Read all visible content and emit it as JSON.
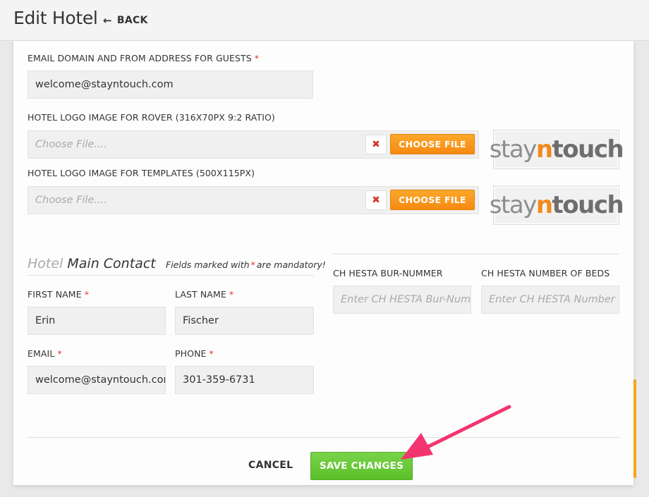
{
  "header": {
    "title": "Edit Hotel",
    "back_label": "BACK"
  },
  "form": {
    "email_domain": {
      "label": "EMAIL DOMAIN AND FROM ADDRESS FOR GUESTS",
      "value": "welcome@stayntouch.com"
    },
    "logo_rover": {
      "label": "HOTEL LOGO IMAGE FOR ROVER (316X70PX 9:2 RATIO)",
      "placeholder": "Choose File....",
      "choose_label": "CHOOSE FILE",
      "remove_label": "✖"
    },
    "logo_templates": {
      "label": "HOTEL LOGO IMAGE FOR TEMPLATES (500X115PX)",
      "placeholder": "Choose File....",
      "choose_label": "CHOOSE FILE",
      "remove_label": "✖"
    },
    "logo_text": {
      "part1": "stay",
      "part2": "n",
      "part3": "touch"
    },
    "main_contact": {
      "title_light": "Hotel",
      "title_dark": "Main Contact",
      "note_before": "Fields marked with",
      "note_after": "are mandatory!",
      "required_mark": "*",
      "first_name": {
        "label": "FIRST NAME",
        "value": "Erin"
      },
      "last_name": {
        "label": "LAST NAME",
        "value": "Fischer"
      },
      "email": {
        "label": "EMAIL",
        "value": "welcome@stayntouch.con"
      },
      "phone": {
        "label": "PHONE",
        "value": "301-359-6731"
      }
    },
    "ch_hesta": {
      "bur_nummer": {
        "label": "CH HESTA BUR-NUMMER",
        "placeholder": "Enter CH HESTA Bur-Numm"
      },
      "beds": {
        "label": "CH HESTA NUMBER OF BEDS",
        "placeholder": "Enter CH HESTA Number of"
      }
    }
  },
  "actions": {
    "cancel_label": "CANCEL",
    "save_label": "SAVE CHANGES"
  },
  "colors": {
    "accent_orange": "#f68a10",
    "save_green": "#5cc02a",
    "required_red": "#e0352b",
    "annotation_pink": "#f2356f"
  }
}
